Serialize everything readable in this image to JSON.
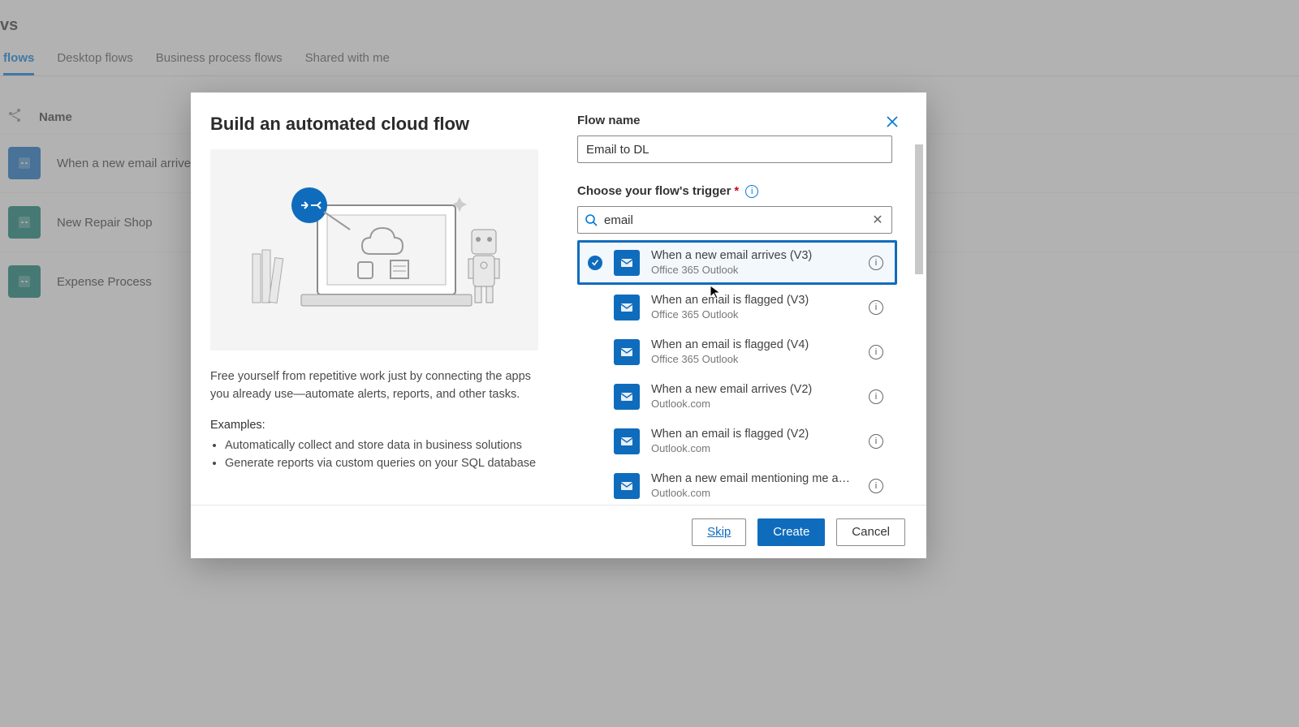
{
  "bg": {
    "title_suffix": "vs",
    "tabs": [
      "flows",
      "Desktop flows",
      "Business process flows",
      "Shared with me"
    ],
    "active_tab_index": 0,
    "name_header": "Name",
    "rows": [
      {
        "name": "When a new email arrives",
        "color": "blue"
      },
      {
        "name": "New Repair Shop",
        "color": "teal"
      },
      {
        "name": "Expense Process",
        "color": "teal"
      }
    ]
  },
  "modal": {
    "title": "Build an automated cloud flow",
    "desc": "Free yourself from repetitive work just by connecting the apps you already use—automate alerts, reports, and other tasks.",
    "examples_h": "Examples:",
    "examples": [
      "Automatically collect and store data in business solutions",
      "Generate reports via custom queries on your SQL database"
    ],
    "flow_name_label": "Flow name",
    "flow_name_value": "Email to DL",
    "trigger_label": "Choose your flow's trigger",
    "search_value": "email",
    "triggers": [
      {
        "name": "When a new email arrives (V3)",
        "sub": "Office 365 Outlook",
        "selected": true
      },
      {
        "name": "When an email is flagged (V3)",
        "sub": "Office 365 Outlook",
        "selected": false
      },
      {
        "name": "When an email is flagged (V4)",
        "sub": "Office 365 Outlook",
        "selected": false
      },
      {
        "name": "When a new email arrives (V2)",
        "sub": "Outlook.com",
        "selected": false
      },
      {
        "name": "When an email is flagged (V2)",
        "sub": "Outlook.com",
        "selected": false
      },
      {
        "name": "When a new email mentioning me a…",
        "sub": "Outlook.com",
        "selected": false
      }
    ],
    "footer": {
      "skip": "Skip",
      "create": "Create",
      "cancel": "Cancel"
    }
  }
}
